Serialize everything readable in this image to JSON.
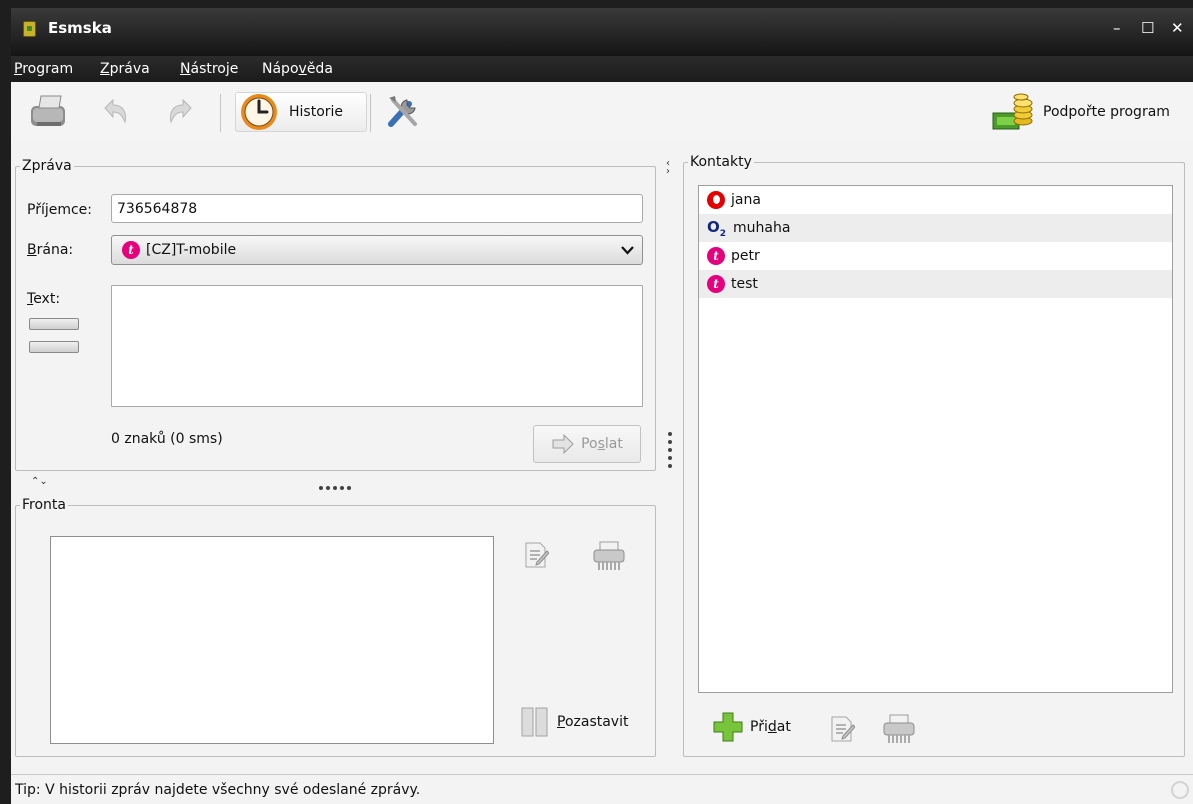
{
  "window": {
    "title": "Esmska",
    "minimize": "–",
    "maximize": "☐",
    "close": "✕"
  },
  "menu": [
    {
      "pre": "",
      "u": "P",
      "post": "rogram"
    },
    {
      "pre": "",
      "u": "Z",
      "post": "práva"
    },
    {
      "pre": "",
      "u": "N",
      "post": "ástroje"
    },
    {
      "pre": "Nápo",
      "u": "v",
      "post": "ěda"
    }
  ],
  "toolbar": {
    "history_label": "Historie",
    "support_label": "Podpořte program"
  },
  "message": {
    "legend": "Zpráva",
    "recipient_pre": "Pří",
    "recipient_u": "j",
    "recipient_post": "emce:",
    "recipient_value": "736564878",
    "gateway_u": "B",
    "gateway_post": "rána:",
    "gateway_value": "[CZ]T-mobile",
    "text_u": "T",
    "text_post": "ext:",
    "text_value": "",
    "counter": "0 znaků (0 sms)",
    "send_pre": "Po",
    "send_u": "s",
    "send_post": "lat"
  },
  "queue": {
    "legend": "Fronta",
    "pause_u": "P",
    "pause_post": "ozastavit"
  },
  "contacts": {
    "legend": "Kontakty",
    "items": [
      {
        "name": "jana",
        "operator": "vodafone"
      },
      {
        "name": "muhaha",
        "operator": "o2"
      },
      {
        "name": "petr",
        "operator": "t-mobile"
      },
      {
        "name": "test",
        "operator": "t-mobile"
      }
    ],
    "add_pre": "Při",
    "add_u": "d",
    "add_post": "at"
  },
  "status": {
    "tip": "Tip: V historii zpráv najdete všechny své odeslané zprávy."
  },
  "colors": {
    "tmobile": "#e6007e",
    "vodafone": "#e60000",
    "o2": "#12297a",
    "titlebar": "#1e1e1e"
  }
}
